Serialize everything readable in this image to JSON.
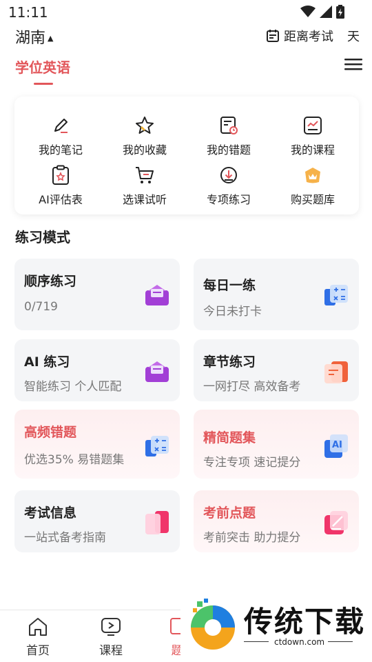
{
  "status_bar": {
    "time": "11:11"
  },
  "header": {
    "region": "湖南",
    "countdown_label": "距离考试",
    "countdown_unit": "天"
  },
  "tabs": {
    "active": "学位英语"
  },
  "shortcuts": [
    {
      "label": "我的笔记",
      "icon": "pencil-note-icon"
    },
    {
      "label": "我的收藏",
      "icon": "star-icon"
    },
    {
      "label": "我的错题",
      "icon": "wrong-questions-icon"
    },
    {
      "label": "我的课程",
      "icon": "course-chart-icon"
    },
    {
      "label": "AI评估表",
      "icon": "clipboard-icon"
    },
    {
      "label": "选课试听",
      "icon": "cart-icon"
    },
    {
      "label": "专项练习",
      "icon": "cloud-download-icon"
    },
    {
      "label": "购买题库",
      "icon": "crown-bag-icon"
    }
  ],
  "practice": {
    "section_title": "练习模式",
    "modes": [
      {
        "title": "顺序练习",
        "subtitle": "0/719",
        "icon": "purple-envelope-icon",
        "highlight": false
      },
      {
        "title": "每日一练",
        "subtitle": "今日未打卡",
        "icon": "blue-calculator-icon",
        "highlight": false
      },
      {
        "title": "AI 练习",
        "subtitle": "智能练习 个人匹配",
        "icon": "purple-envelope-icon",
        "highlight": false
      },
      {
        "title": "章节练习",
        "subtitle": "一网打尽 高效备考",
        "icon": "orange-book-icon",
        "highlight": false
      },
      {
        "title": "高频错题",
        "subtitle": "优选35% 易错题集",
        "icon": "blue-calculator-icon",
        "highlight": true
      },
      {
        "title": "精简题集",
        "subtitle": "专注专项 速记提分",
        "icon": "blue-ai-icon",
        "highlight": true
      },
      {
        "title": "考试信息",
        "subtitle": "一站式备考指南",
        "icon": "pink-cards-icon",
        "highlight": false
      },
      {
        "title": "考前点题",
        "subtitle": "考前突击 助力提分",
        "icon": "pink-pen-icon",
        "highlight": true
      }
    ]
  },
  "bottom_nav": {
    "items": [
      {
        "label": "首页",
        "icon": "home-icon"
      },
      {
        "label": "课程",
        "icon": "play-icon"
      },
      {
        "label": "题",
        "icon": "question-icon"
      }
    ]
  },
  "watermark": {
    "brand": "传统下载",
    "url": "ctdown.com"
  },
  "colors": {
    "accent": "#e2565a",
    "card_bg": "#f4f5f7",
    "text": "#222222",
    "subtext": "#777777"
  }
}
